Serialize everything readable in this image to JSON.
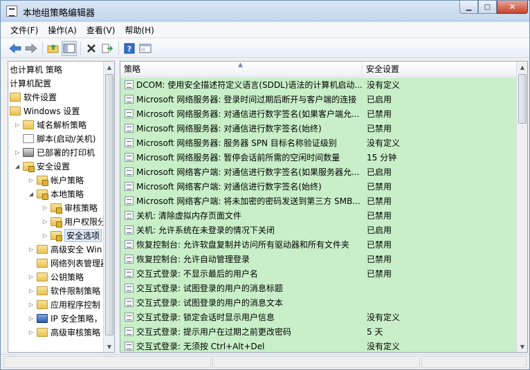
{
  "window": {
    "title": "本地组策略编辑器"
  },
  "menu": [
    "文件(F)",
    "操作(A)",
    "查看(V)",
    "帮助(H)"
  ],
  "toolbar": {
    "icons": [
      "back-icon",
      "forward-icon",
      "up-folder-icon",
      "show-hide-tree-icon",
      "delete-icon",
      "export-icon",
      "help-icon",
      "properties-icon"
    ]
  },
  "tree": {
    "items": [
      {
        "label": "也计算机 策略",
        "level": 0,
        "arrow": "",
        "icon": "none"
      },
      {
        "label": "计算机配置",
        "level": 0,
        "arrow": "",
        "icon": "none"
      },
      {
        "label": "软件设置",
        "level": 0,
        "arrow": "",
        "icon": "folder"
      },
      {
        "label": "Windows 设置",
        "level": 0,
        "arrow": "",
        "icon": "folder"
      },
      {
        "label": "域名解析策略",
        "level": 1,
        "arrow": "▷",
        "icon": "folder"
      },
      {
        "label": "脚本(启动/关机)",
        "level": 1,
        "arrow": "",
        "icon": "doc"
      },
      {
        "label": "已部署的打印机",
        "level": 1,
        "arrow": "▷",
        "icon": "printer"
      },
      {
        "label": "安全设置",
        "level": 1,
        "arrow": "◢",
        "icon": "folder-lock"
      },
      {
        "label": "帐户策略",
        "level": 2,
        "arrow": "▷",
        "icon": "folder-lock"
      },
      {
        "label": "本地策略",
        "level": 2,
        "arrow": "◢",
        "icon": "folder-lock"
      },
      {
        "label": "审核策略",
        "level": 3,
        "arrow": "▷",
        "icon": "folder-lock"
      },
      {
        "label": "用户权限分",
        "level": 3,
        "arrow": "▷",
        "icon": "folder-lock"
      },
      {
        "label": "安全选项",
        "level": 3,
        "arrow": "▷",
        "icon": "folder-lock",
        "selected": true
      },
      {
        "label": "高级安全 Win",
        "level": 2,
        "arrow": "▷",
        "icon": "folder"
      },
      {
        "label": "网络列表管理器",
        "level": 2,
        "arrow": "",
        "icon": "folder"
      },
      {
        "label": "公钥策略",
        "level": 2,
        "arrow": "▷",
        "icon": "folder"
      },
      {
        "label": "软件限制策略",
        "level": 2,
        "arrow": "▷",
        "icon": "folder"
      },
      {
        "label": "应用程序控制",
        "level": 2,
        "arrow": "▷",
        "icon": "folder"
      },
      {
        "label": "IP 安全策略，",
        "level": 2,
        "arrow": "▷",
        "icon": "net"
      },
      {
        "label": "高级审核策略",
        "level": 2,
        "arrow": "▷",
        "icon": "folder"
      }
    ]
  },
  "table": {
    "columns": [
      "策略",
      "安全设置"
    ],
    "rows": [
      {
        "policy": "DCOM: 使用安全描述符定义语言(SDDL)语法的计算机启动...",
        "setting": "没有定义"
      },
      {
        "policy": "Microsoft 网络服务器: 登录时间过期后断开与客户端的连接",
        "setting": "已启用"
      },
      {
        "policy": "Microsoft 网络服务器: 对通信进行数字签名(如果客户端允...",
        "setting": "已禁用"
      },
      {
        "policy": "Microsoft 网络服务器: 对通信进行数字签名(始终)",
        "setting": "已禁用"
      },
      {
        "policy": "Microsoft 网络服务器: 服务器 SPN 目标名称验证级别",
        "setting": "没有定义"
      },
      {
        "policy": "Microsoft 网络服务器: 暂停会话前所需的空闲时间数量",
        "setting": "15 分钟"
      },
      {
        "policy": "Microsoft 网络客户端: 对通信进行数字签名(如果服务器允...",
        "setting": "已启用"
      },
      {
        "policy": "Microsoft 网络客户端: 对通信进行数字签名(始终)",
        "setting": "已禁用"
      },
      {
        "policy": "Microsoft 网络客户端: 将未加密的密码发送到第三方 SMB...",
        "setting": "已禁用"
      },
      {
        "policy": "关机: 清除虚拟内存页面文件",
        "setting": "已禁用"
      },
      {
        "policy": "关机: 允许系统在未登录的情况下关闭",
        "setting": "已启用"
      },
      {
        "policy": "恢复控制台: 允许软盘复制并访问所有驱动器和所有文件夹",
        "setting": "已禁用"
      },
      {
        "policy": "恢复控制台: 允许自动管理登录",
        "setting": "已禁用"
      },
      {
        "policy": "交互式登录: 不显示最后的用户名",
        "setting": "已禁用"
      },
      {
        "policy": "交互式登录: 试图登录的用户的消息标题",
        "setting": ""
      },
      {
        "policy": "交互式登录: 试图登录的用户的消息文本",
        "setting": ""
      },
      {
        "policy": "交互式登录: 锁定会话时显示用户信息",
        "setting": "没有定义"
      },
      {
        "policy": "交互式登录: 提示用户在过期之前更改密码",
        "setting": "5 天"
      },
      {
        "policy": "交互式登录: 无须按 Ctrl+Alt+Del",
        "setting": "没有定义"
      }
    ]
  },
  "colors": {
    "row_background": "#c8efc8",
    "title_gradient": "#c4d7ee"
  }
}
